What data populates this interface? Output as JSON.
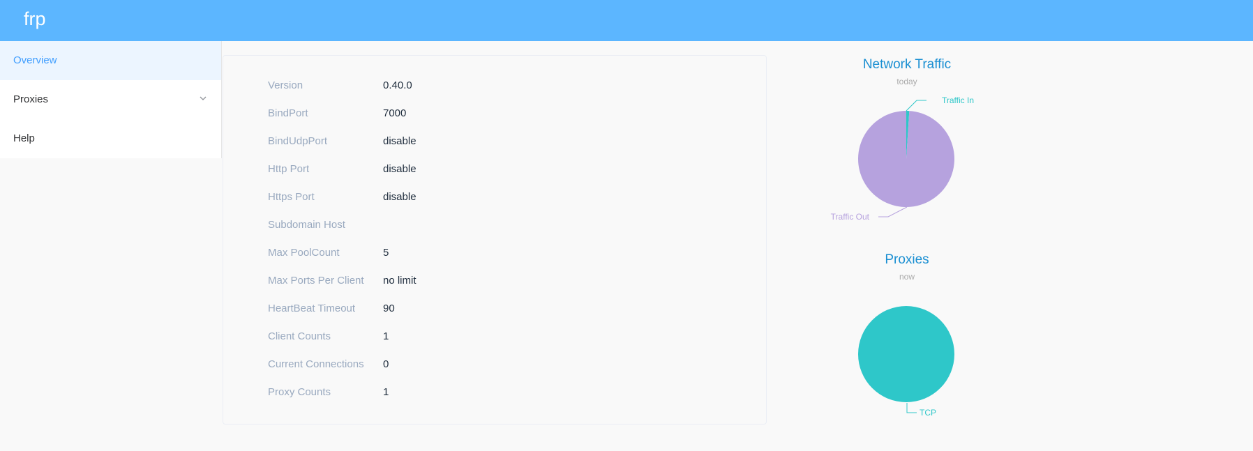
{
  "app": {
    "brand": "frp"
  },
  "sidebar": {
    "items": [
      {
        "label": "Overview",
        "active": true
      },
      {
        "label": "Proxies",
        "has_submenu": true
      },
      {
        "label": "Help"
      }
    ]
  },
  "overview": {
    "rows": [
      {
        "key": "Version",
        "value": "0.40.0"
      },
      {
        "key": "BindPort",
        "value": "7000"
      },
      {
        "key": "BindUdpPort",
        "value": "disable"
      },
      {
        "key": "Http Port",
        "value": "disable"
      },
      {
        "key": "Https Port",
        "value": "disable"
      },
      {
        "key": "Subdomain Host",
        "value": ""
      },
      {
        "key": "Max PoolCount",
        "value": "5"
      },
      {
        "key": "Max Ports Per Client",
        "value": "no limit"
      },
      {
        "key": "HeartBeat Timeout",
        "value": "90"
      },
      {
        "key": "Client Counts",
        "value": "1"
      },
      {
        "key": "Current Connections",
        "value": "0"
      },
      {
        "key": "Proxy Counts",
        "value": "1"
      }
    ]
  },
  "colors": {
    "header": "#5cb6ff",
    "chart_title": "#1a8fd2",
    "traffic_in": "#2ec7c9",
    "traffic_out": "#b6a2de",
    "tcp": "#2ec7c9"
  },
  "chart_data": [
    {
      "type": "pie",
      "title": "Network Traffic",
      "subtitle": "today",
      "categories": [
        "Traffic In",
        "Traffic Out"
      ],
      "values": [
        1,
        99
      ]
    },
    {
      "type": "pie",
      "title": "Proxies",
      "subtitle": "now",
      "categories": [
        "TCP"
      ],
      "values": [
        1
      ]
    }
  ]
}
